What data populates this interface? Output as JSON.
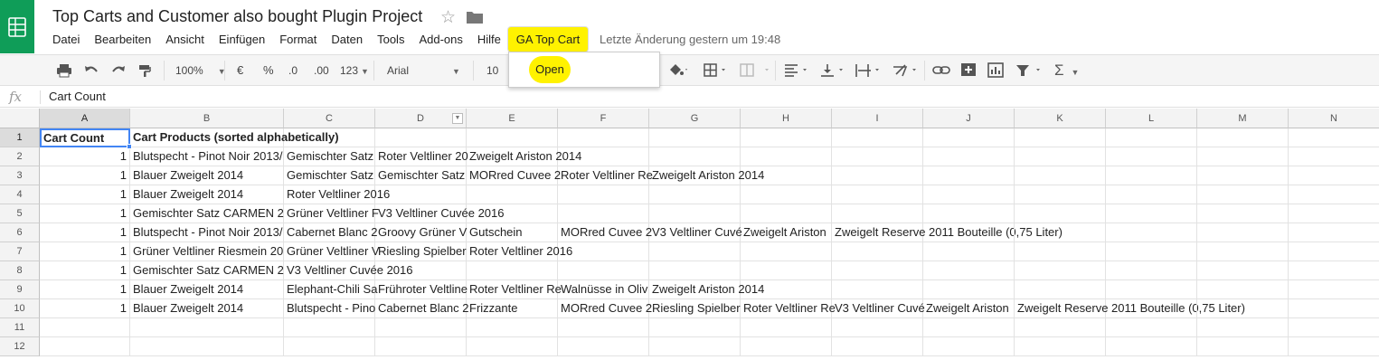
{
  "header": {
    "title": "Top Carts and Customer also bought Plugin Project",
    "menu": [
      "Datei",
      "Bearbeiten",
      "Ansicht",
      "Einfügen",
      "Format",
      "Daten",
      "Tools",
      "Add-ons",
      "Hilfe"
    ],
    "addon_menu": "GA Top Cart",
    "last_edit": "Letzte Änderung gestern um 19:48",
    "accent_color": "#0f9d58",
    "highlight_color": "#fff200"
  },
  "toolbar": {
    "zoom": "100%",
    "currency": "€",
    "percent": "%",
    "dec_less": ".0",
    "dec_more": ".00",
    "format_more": "123",
    "font": "Arial",
    "font_size": "10"
  },
  "dropdown": {
    "open_label": "Open"
  },
  "formula_bar": {
    "fx": "fx",
    "value": "Cart Count"
  },
  "grid": {
    "columns": [
      "A",
      "B",
      "C",
      "D",
      "E",
      "F",
      "G",
      "H",
      "I",
      "J",
      "K",
      "L",
      "M",
      "N"
    ],
    "rows": [
      [
        "1",
        "Cart Count",
        "Cart Products (sorted alphabetically)",
        "",
        "",
        "",
        "",
        "",
        "",
        "",
        "",
        "",
        "",
        "",
        ""
      ],
      [
        "2",
        "1",
        "Blutspecht - Pinot Noir 2013/",
        "Gemischter Satz",
        "Roter Veltliner 20",
        "Zweigelt Ariston 2014",
        "",
        "",
        "",
        "",
        "",
        "",
        "",
        "",
        ""
      ],
      [
        "3",
        "1",
        "Blauer Zweigelt 2014",
        "Gemischter Satz",
        "Gemischter Satz",
        "MORred Cuvee 2",
        "Roter Veltliner Re",
        "Zweigelt Ariston 2014",
        "",
        "",
        "",
        "",
        "",
        "",
        ""
      ],
      [
        "4",
        "1",
        "Blauer Zweigelt 2014",
        "Roter Veltliner 2016",
        "",
        "",
        "",
        "",
        "",
        "",
        "",
        "",
        "",
        "",
        ""
      ],
      [
        "5",
        "1",
        "Gemischter Satz CARMEN 2",
        "Grüner Veltliner F",
        "V3 Veltliner Cuvée 2016",
        "",
        "",
        "",
        "",
        "",
        "",
        "",
        "",
        "",
        ""
      ],
      [
        "6",
        "1",
        "Blutspecht - Pinot Noir 2013/",
        "Cabernet Blanc 2",
        "Groovy Grüner V",
        "Gutschein",
        "MORred Cuvee 2",
        "V3 Veltliner Cuvé",
        "Zweigelt Ariston",
        "Zweigelt Reserve 2011 Bouteille (0,75 Liter)",
        "",
        "",
        "",
        "",
        ""
      ],
      [
        "7",
        "1",
        "Grüner Veltliner Riesmein 20",
        "Grüner Veltliner V",
        "Riesling Spielber",
        "Roter Veltliner 2016",
        "",
        "",
        "",
        "",
        "",
        "",
        "",
        "",
        ""
      ],
      [
        "8",
        "1",
        "Gemischter Satz CARMEN 2",
        "V3 Veltliner Cuvée 2016",
        "",
        "",
        "",
        "",
        "",
        "",
        "",
        "",
        "",
        "",
        ""
      ],
      [
        "9",
        "1",
        "Blauer Zweigelt 2014",
        "Elephant-Chili Sa",
        "Frühroter Veltline",
        "Roter Veltliner Re",
        "Walnüsse in Oliv",
        "Zweigelt Ariston 2014",
        "",
        "",
        "",
        "",
        "",
        "",
        ""
      ],
      [
        "10",
        "1",
        "Blauer Zweigelt 2014",
        "Blutspecht - Pino",
        "Cabernet Blanc 2",
        "Frizzante",
        "MORred Cuvee 2",
        "Riesling Spielber",
        "Roter Veltliner Re",
        "V3 Veltliner Cuvé",
        "Zweigelt Ariston",
        "Zweigelt Reserve 2011 Bouteille (0,75 Liter)",
        "",
        "",
        ""
      ],
      [
        "11",
        "",
        "",
        "",
        "",
        "",
        "",
        "",
        "",
        "",
        "",
        "",
        "",
        "",
        ""
      ],
      [
        "12",
        "",
        "",
        "",
        "",
        "",
        "",
        "",
        "",
        "",
        "",
        "",
        "",
        "",
        ""
      ]
    ]
  }
}
